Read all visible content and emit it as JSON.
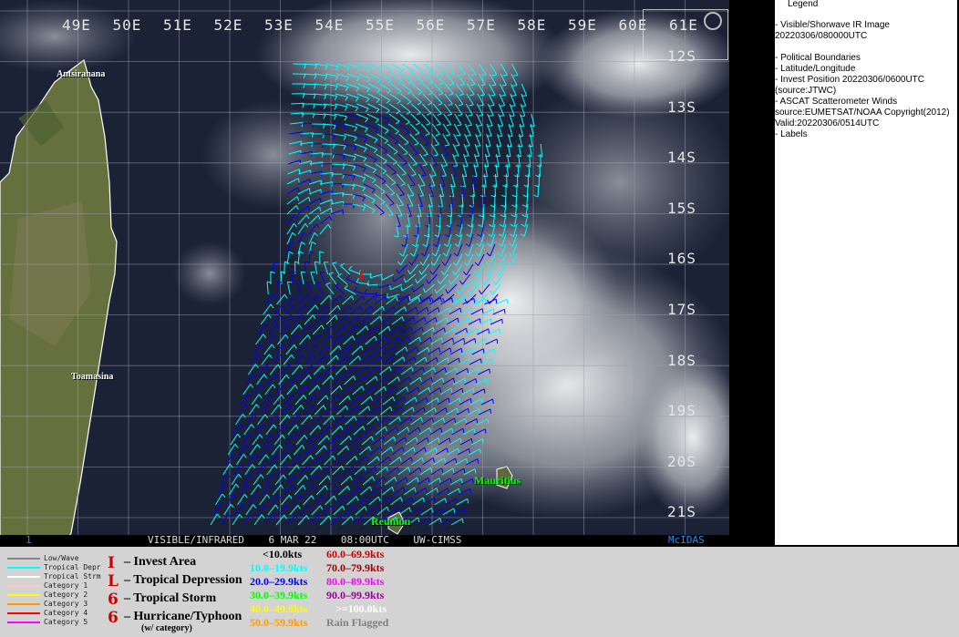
{
  "map": {
    "lon_labels": [
      "49E",
      "50E",
      "51E",
      "52E",
      "53E",
      "54E",
      "55E",
      "56E",
      "57E",
      "58E",
      "59E",
      "60E",
      "61E"
    ],
    "lat_labels": [
      "12S",
      "13S",
      "14S",
      "15S",
      "16S",
      "17S",
      "18S",
      "19S",
      "20S",
      "21S"
    ],
    "places": [
      "Antsiranana",
      "Toamasina",
      "Mauritius",
      "Reunion"
    ],
    "footer_left": "1",
    "footer_center": "VISIBLE/INFRARED    6 MAR 22    08:00UTC    UW-CIMSS",
    "footer_right": "McIDAS",
    "invest_marker": "I",
    "colors": {
      "ocean": "#1a2338",
      "land": "#6a7446",
      "cyan": "#00ffff",
      "blue": "#0000ff",
      "grid": "#9aa0aa"
    }
  },
  "legend": {
    "title": "Legend",
    "lines": [
      "-  Visible/Shorwave IR Image",
      "20220306/080000UTC",
      "",
      "-  Political Boundaries",
      "-  Latitude/Longitude",
      "-  Invest Position  20220306/0600UTC",
      "(source:JTWC)",
      "-  ASCAT Scatterometer Winds",
      "source:EUMETSAT/NOAA  Copyright(2012)",
      "Valid:20220306/0514UTC",
      "-  Labels"
    ]
  },
  "key": {
    "track_types": [
      {
        "label": "Low/Wave",
        "color": "#888888"
      },
      {
        "label": "Tropical Depr",
        "color": "#00ffff"
      },
      {
        "label": "Tropical Strm",
        "color": "#ffffff"
      },
      {
        "label": "Category 1",
        "color": "#ffc8c8"
      },
      {
        "label": "Category 2",
        "color": "#ffff00"
      },
      {
        "label": "Category 3",
        "color": "#ff9900"
      },
      {
        "label": "Category 4",
        "color": "#ff0000"
      },
      {
        "label": "Category 5",
        "color": "#ff00ff"
      }
    ],
    "symbols": [
      {
        "glyph": "I",
        "label": "– Invest Area"
      },
      {
        "glyph": "L",
        "label": "– Tropical Depression"
      },
      {
        "glyph": "6",
        "label": "– Tropical Storm"
      },
      {
        "glyph": "6",
        "label": "– Hurricane/Typhoon"
      }
    ],
    "symbol_note": "(w/ category)",
    "speeds": [
      {
        "label": "<10.0kts",
        "color": "#000000"
      },
      {
        "label": "10.0–19.9kts",
        "color": "#00ffff"
      },
      {
        "label": "20.0–29.9kts",
        "color": "#0000ff"
      },
      {
        "label": "30.0–39.9kts",
        "color": "#00ff00"
      },
      {
        "label": "40.0–49.9kts",
        "color": "#ffff00"
      },
      {
        "label": "50.0–59.9kts",
        "color": "#ff9900"
      },
      {
        "label": "60.0–69.9kts",
        "color": "#cc0000"
      },
      {
        "label": "70.0–79.9kts",
        "color": "#990000"
      },
      {
        "label": "80.0–89.9kts",
        "color": "#ff00ff"
      },
      {
        "label": "90.0–99.9kts",
        "color": "#990099"
      },
      {
        "label": ">=100.0kts",
        "color": "#ffffff"
      },
      {
        "label": "Rain Flagged",
        "color": "#808080"
      }
    ]
  }
}
